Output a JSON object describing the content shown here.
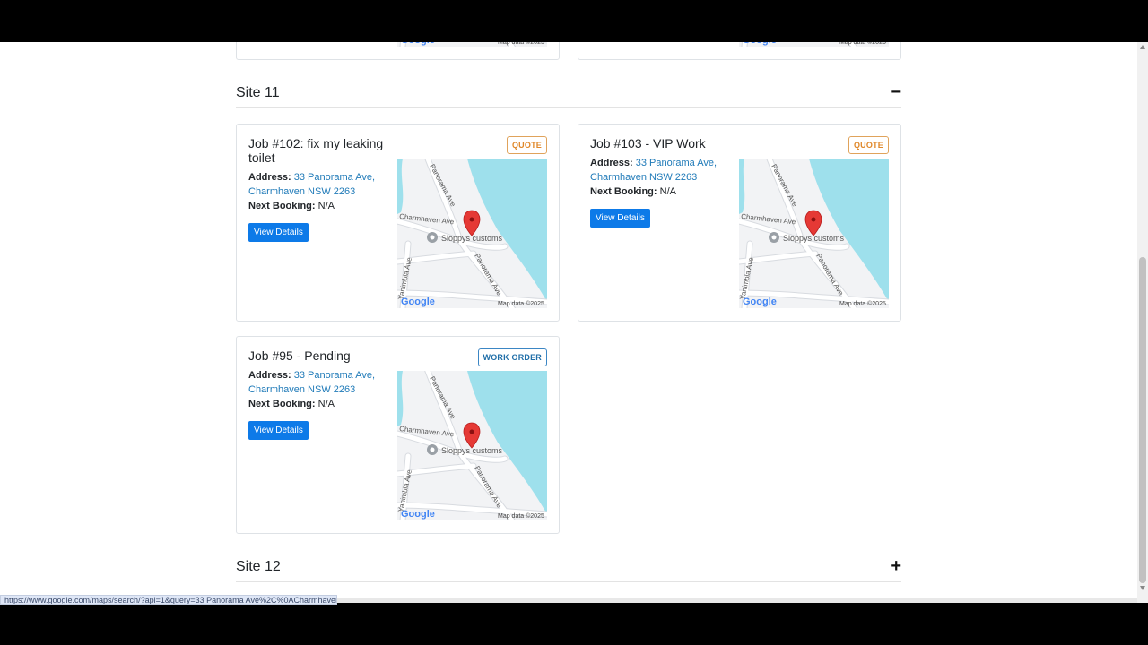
{
  "sections": [
    {
      "title": "Site 11",
      "toggle": "−"
    },
    {
      "title": "Site 12",
      "toggle": "+"
    }
  ],
  "cards": [
    {
      "title": "Job #102: fix my leaking toilet",
      "badge": "QUOTE",
      "address_label": "Address:",
      "address": "33 Panorama Ave, Charmhaven NSW 2263",
      "booking_label": "Next Booking:",
      "booking": "N/A",
      "button": "View Details"
    },
    {
      "title": "Job #103 - VIP Work",
      "badge": "QUOTE",
      "address_label": "Address:",
      "address": "33 Panorama Ave, Charmhaven NSW 2263",
      "booking_label": "Next Booking:",
      "booking": "N/A",
      "button": "View Details"
    },
    {
      "title": "Job #95 - Pending",
      "badge": "WORK ORDER",
      "address_label": "Address:",
      "address": "33 Panorama Ave, Charmhaven NSW 2263",
      "booking_label": "Next Booking:",
      "booking": "N/A",
      "button": "View Details"
    }
  ],
  "map": {
    "place": "Sloppys customs",
    "streets": [
      "Panorama Ave",
      "Charmhaven Ave",
      "Panorama Ave",
      "Yanimbla Ave"
    ],
    "provider": "Google",
    "attribution": "Map data ©2025",
    "water_color": "#9ee0ec",
    "pin_color": "#e53935"
  },
  "status_url": "https://www.google.com/maps/search/?api=1&query=33 Panorama Ave%2C%0ACharmhaven NSW 2263"
}
